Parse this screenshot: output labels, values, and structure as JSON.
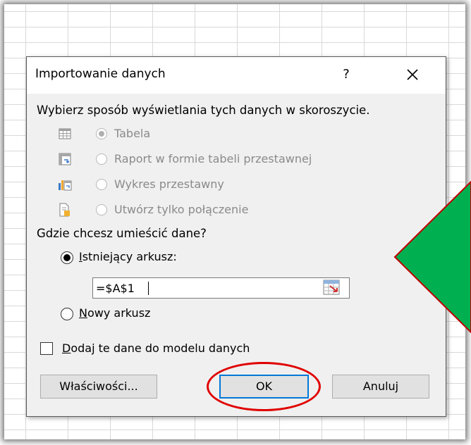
{
  "dialog": {
    "title": "Importowanie danych",
    "help_glyph": "?",
    "close_glyph": "✕",
    "section1_label": "Wybierz sposób wyświetlania tych danych w skoroszycie.",
    "view_options": [
      {
        "label": "Tabela",
        "icon": "table-icon",
        "selected": true,
        "enabled": false
      },
      {
        "label": "Raport w formie tabeli przestawnej",
        "icon": "pivot-table-icon",
        "selected": false,
        "enabled": false
      },
      {
        "label": "Wykres przestawny",
        "icon": "pivot-chart-icon",
        "selected": false,
        "enabled": false
      },
      {
        "label": "Utwórz tylko połączenie",
        "icon": "connection-icon",
        "selected": false,
        "enabled": false
      }
    ],
    "section2_label": "Gdzie chcesz umieścić dane?",
    "existing_sheet": {
      "label_u": "I",
      "label_rest": "stniejący arkusz:",
      "selected": true
    },
    "location_value": "=$A$1",
    "new_sheet": {
      "label_u": "N",
      "label_rest": "owy arkusz",
      "selected": false
    },
    "data_model": {
      "label_u": "D",
      "label_rest": "odaj te dane do modelu danych",
      "checked": false
    },
    "buttons": {
      "properties": "Właściwości...",
      "ok": "OK",
      "cancel": "Anuluj"
    }
  },
  "colors": {
    "highlight_ellipse": "#e00000",
    "arrow_fill": "#00b050",
    "arrow_stroke": "#c00000",
    "default_button_border": "#0078d7"
  }
}
